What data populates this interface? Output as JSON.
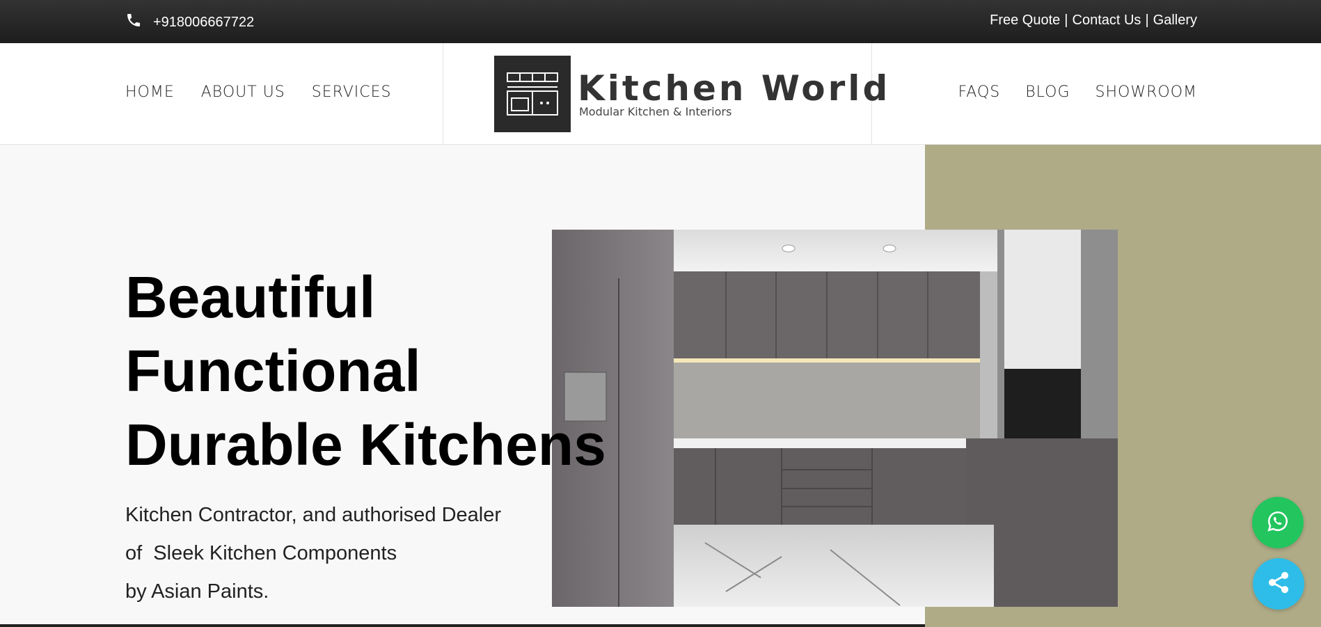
{
  "topbar": {
    "phone": "+918006667722",
    "links": [
      "Free Quote",
      "Contact Us",
      "Gallery"
    ],
    "separator": "|"
  },
  "nav": {
    "left": [
      "HOME",
      "ABOUT US",
      "SERVICES"
    ],
    "right": [
      "FAQS",
      "BLOG",
      "SHOWROOM"
    ]
  },
  "logo": {
    "title": "Kitchen World",
    "subtitle": "Modular Kitchen & Interiors"
  },
  "hero": {
    "headline": [
      "Beautiful",
      "Functional",
      "Durable Kitchens"
    ],
    "subtext": [
      "Kitchen Contractor, and authorised Dealer",
      "of  Sleek Kitchen Components",
      "by Asian Paints."
    ]
  },
  "colors": {
    "topbar": "#1d1d1d",
    "olive_panel": "#afab86",
    "whatsapp": "#22c55e",
    "share": "#2ebde8"
  },
  "icons": {
    "phone": "phone-icon",
    "whatsapp": "whatsapp-icon",
    "share": "share-icon"
  }
}
